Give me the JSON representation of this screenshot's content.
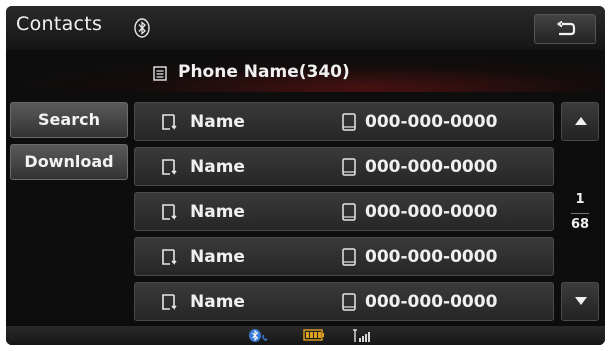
{
  "header": {
    "title": "Contacts",
    "bluetooth_icon": "bluetooth-icon",
    "back_icon": "back-arrow-icon"
  },
  "phonebook": {
    "icon": "list-icon",
    "label": "Phone Name(340)"
  },
  "side_buttons": [
    {
      "label": "Search"
    },
    {
      "label": "Download"
    }
  ],
  "contacts": [
    {
      "name": "Name",
      "number": "000-000-0000"
    },
    {
      "name": "Name",
      "number": "000-000-0000"
    },
    {
      "name": "Name",
      "number": "000-000-0000"
    },
    {
      "name": "Name",
      "number": "000-000-0000"
    },
    {
      "name": "Name",
      "number": "000-000-0000"
    }
  ],
  "pagination": {
    "current": "1",
    "total": "68"
  },
  "status_icons": [
    "bluetooth-phone-icon",
    "battery-icon",
    "signal-strength-icon"
  ],
  "colors": {
    "background": "#0d0d0d",
    "text": "#f0f0f0",
    "accent_glow": "#781414",
    "battery": "#e0a020",
    "bluetooth": "#3a7bd5"
  }
}
